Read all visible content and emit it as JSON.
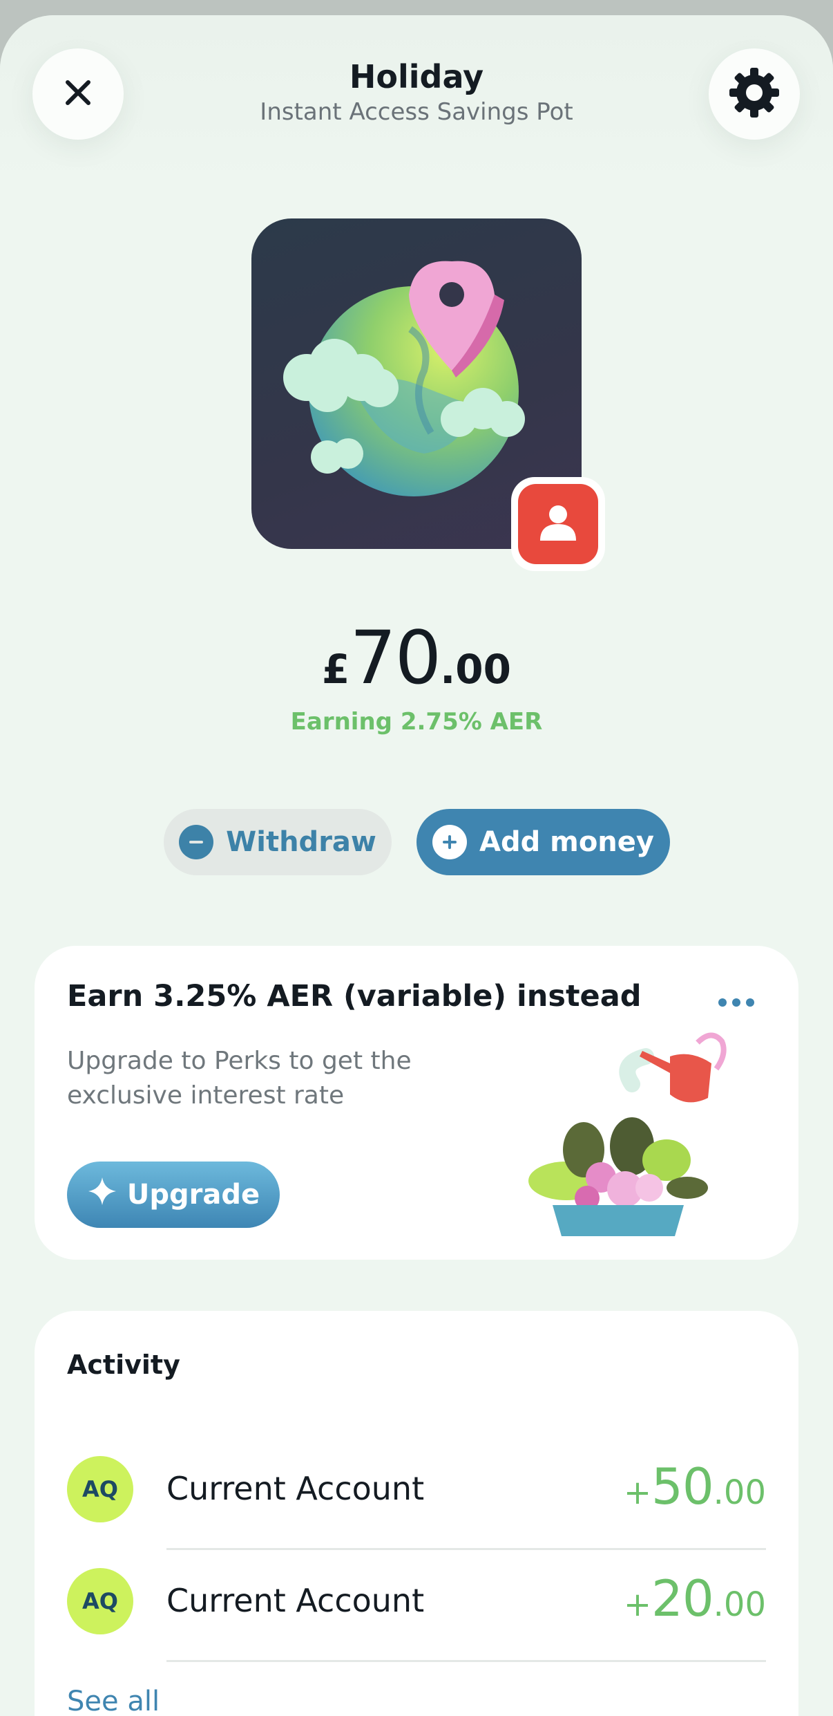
{
  "header": {
    "title": "Holiday",
    "subtitle": "Instant Access Savings Pot",
    "close_icon": "close-icon",
    "settings_icon": "gear-icon"
  },
  "pot": {
    "image": "globe-with-location-pin-illustration",
    "owner_badge_icon": "person-icon"
  },
  "balance": {
    "currency_symbol": "£",
    "major": "70",
    "minor": ".00",
    "rate_text": "Earning 2.75% AER"
  },
  "actions": {
    "withdraw_label": "Withdraw",
    "withdraw_icon": "minus-circle-icon",
    "add_money_label": "Add money",
    "add_money_icon": "plus-circle-icon"
  },
  "promo": {
    "title": "Earn 3.25% AER (variable) instead",
    "description": "Upgrade to Perks to get the exclusive interest rate",
    "button_label": "Upgrade",
    "button_icon": "sparkle-icon",
    "more_icon": "more-dots-icon",
    "illustration": "watering-can-plants-illustration"
  },
  "activity": {
    "title": "Activity",
    "items": [
      {
        "initials": "AQ",
        "name": "Current Account",
        "sign": "+",
        "major": "50",
        "minor": ".00"
      },
      {
        "initials": "AQ",
        "name": "Current Account",
        "sign": "+",
        "major": "20",
        "minor": ".00"
      }
    ],
    "see_all": "See all"
  },
  "colors": {
    "background": "#eef6f0",
    "accent_blue": "#3f85b0",
    "positive_green": "#6cc06a",
    "avatar_lime": "#cdf25d",
    "badge_red": "#e8493d"
  }
}
